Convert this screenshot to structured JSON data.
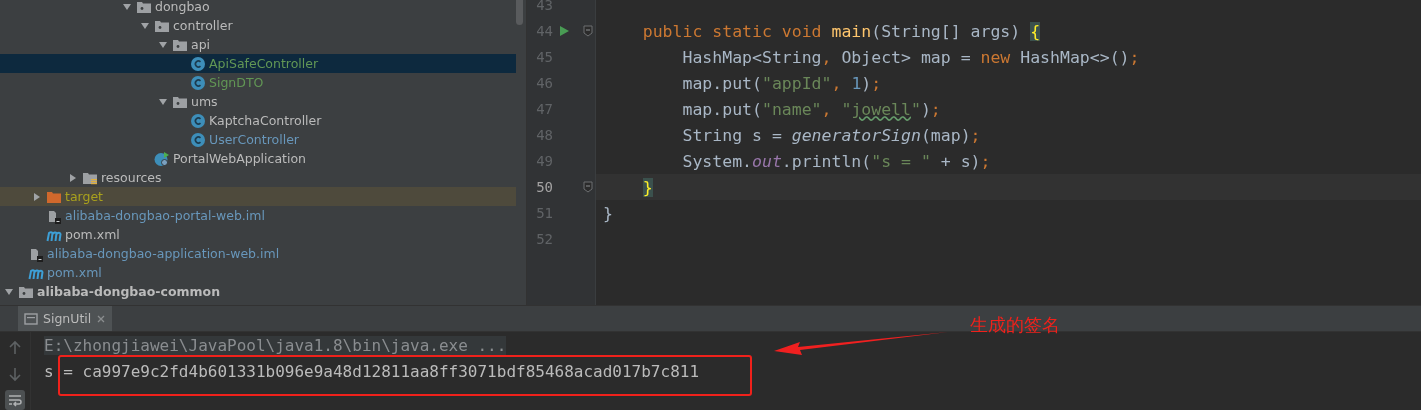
{
  "project_tree": [
    {
      "children": [
        {
          "children": [
            {
              "children": [
                {
                  "children": [
                    {
                      "children": [
                        {
                          "children": [
                            {
                              "children": [
                                {
                                  "label": "dongbao",
                                  "kind": "package",
                                  "expanded": true,
                                  "selected": false,
                                  "children": [
                                    {
                                      "label": "controller",
                                      "kind": "package",
                                      "expanded": true,
                                      "selected": false,
                                      "children": [
                                        {
                                          "label": "api",
                                          "kind": "package",
                                          "expanded": true,
                                          "selected": false,
                                          "children": [
                                            {
                                              "label": "ApiSafeController",
                                              "kind": "class",
                                              "color": "#629755",
                                              "selected": true
                                            },
                                            {
                                              "label": "SignDTO",
                                              "kind": "class",
                                              "color": "#629755",
                                              "selected": false
                                            }
                                          ]
                                        },
                                        {
                                          "label": "ums",
                                          "kind": "package",
                                          "expanded": true,
                                          "selected": false,
                                          "children": [
                                            {
                                              "label": "KaptchaController",
                                              "kind": "class",
                                              "color": "#bbbbbb",
                                              "selected": false
                                            },
                                            {
                                              "label": "UserController",
                                              "kind": "class",
                                              "color": "#6897bb",
                                              "selected": false
                                            }
                                          ]
                                        }
                                      ]
                                    },
                                    {
                                      "label": "PortalWebApplication",
                                      "kind": "app-class",
                                      "color": "#bbbbbb",
                                      "selected": false
                                    }
                                  ]
                                }
                              ]
                            }
                          ]
                        }
                      ]
                    },
                    {
                      "label": "resources",
                      "kind": "resources",
                      "expanded": false,
                      "selected": false
                    }
                  ]
                }
              ]
            },
            {
              "label": "target",
              "kind": "excluded-folder",
              "expanded": false,
              "color": "#a9a11d",
              "selected": false
            },
            {
              "label": "alibaba-dongbao-portal-web.iml",
              "kind": "module-file",
              "color": "#6897bb",
              "selected": false
            },
            {
              "label": "pom.xml",
              "kind": "maven",
              "color": "#bbbbbb",
              "selected": false
            }
          ]
        },
        {
          "label": "alibaba-dongbao-application-web.iml",
          "kind": "module-file",
          "color": "#6897bb",
          "selected": false
        },
        {
          "label": "pom.xml",
          "kind": "maven",
          "color": "#6897bb",
          "selected": false
        }
      ]
    },
    {
      "label": "alibaba-dongbao-common",
      "kind": "module",
      "expanded": true,
      "selected": false
    }
  ],
  "editor": {
    "lines": [
      {
        "number": "43",
        "current": false
      },
      {
        "number": "44",
        "current": false,
        "run": true,
        "fold": true,
        "tokens": [
          {
            "text": "    public static void ",
            "kind": "keyword"
          },
          {
            "text": "main",
            "kind": "function"
          },
          {
            "text": "(String[] args) ",
            "kind": "plain"
          },
          {
            "text": "{",
            "kind": "brace-match"
          }
        ]
      },
      {
        "number": "45",
        "current": false,
        "tokens": [
          {
            "text": "        HashMap<String",
            "kind": "plain"
          },
          {
            "text": ", ",
            "kind": "punct"
          },
          {
            "text": "Object> map = ",
            "kind": "plain"
          },
          {
            "text": "new ",
            "kind": "keyword"
          },
          {
            "text": "HashMap<>()",
            "kind": "plain"
          },
          {
            "text": ";",
            "kind": "punct"
          }
        ]
      },
      {
        "number": "46",
        "current": false,
        "tokens": [
          {
            "text": "        map.put(",
            "kind": "plain"
          },
          {
            "text": "\"appId\"",
            "kind": "string"
          },
          {
            "text": ", ",
            "kind": "punct"
          },
          {
            "text": "1",
            "kind": "number"
          },
          {
            "text": ")",
            "kind": "plain"
          },
          {
            "text": ";",
            "kind": "punct"
          }
        ]
      },
      {
        "number": "47",
        "current": false,
        "tokens": [
          {
            "text": "        map.put(",
            "kind": "plain"
          },
          {
            "text": "\"name\"",
            "kind": "string"
          },
          {
            "text": ", ",
            "kind": "punct"
          },
          {
            "text": "\"",
            "kind": "string"
          },
          {
            "text": "jowell",
            "kind": "typo-string"
          },
          {
            "text": "\"",
            "kind": "string"
          },
          {
            "text": ")",
            "kind": "plain"
          },
          {
            "text": ";",
            "kind": "punct"
          }
        ]
      },
      {
        "number": "48",
        "current": false,
        "tokens": [
          {
            "text": "        String s = ",
            "kind": "plain"
          },
          {
            "text": "generatorSign",
            "kind": "static-call"
          },
          {
            "text": "(map)",
            "kind": "plain"
          },
          {
            "text": ";",
            "kind": "punct"
          }
        ]
      },
      {
        "number": "49",
        "current": false,
        "tokens": [
          {
            "text": "        System.",
            "kind": "plain"
          },
          {
            "text": "out",
            "kind": "static-field"
          },
          {
            "text": ".println(",
            "kind": "plain"
          },
          {
            "text": "\"s = \"",
            "kind": "string"
          },
          {
            "text": " + s)",
            "kind": "plain"
          },
          {
            "text": ";",
            "kind": "punct"
          }
        ]
      },
      {
        "number": "50",
        "current": true,
        "fold": true,
        "tokens": [
          {
            "text": "    }",
            "kind": "brace-match"
          }
        ]
      },
      {
        "number": "51",
        "current": false,
        "tokens": [
          {
            "text": "}",
            "kind": "plain"
          }
        ]
      },
      {
        "number": "52",
        "current": false
      }
    ]
  },
  "run_panel": {
    "tabs": [
      {
        "label": "SignUtil",
        "selected": true
      }
    ],
    "tools": [
      {
        "kind": "up",
        "on": false
      },
      {
        "kind": "down",
        "on": false
      },
      {
        "kind": "wrap",
        "on": true
      }
    ],
    "console": [
      {
        "text": "E:\\zhongjiawei\\JavaPool\\java1.8\\bin\\java.exe ...",
        "kind": "command"
      },
      {
        "text": "s = ca997e9c2fd4b601331b096e9a48d12811aa8ff3071bdf85468acad017b7c811",
        "kind": "output"
      }
    ]
  },
  "annotation": {
    "label": "生成的签名"
  }
}
